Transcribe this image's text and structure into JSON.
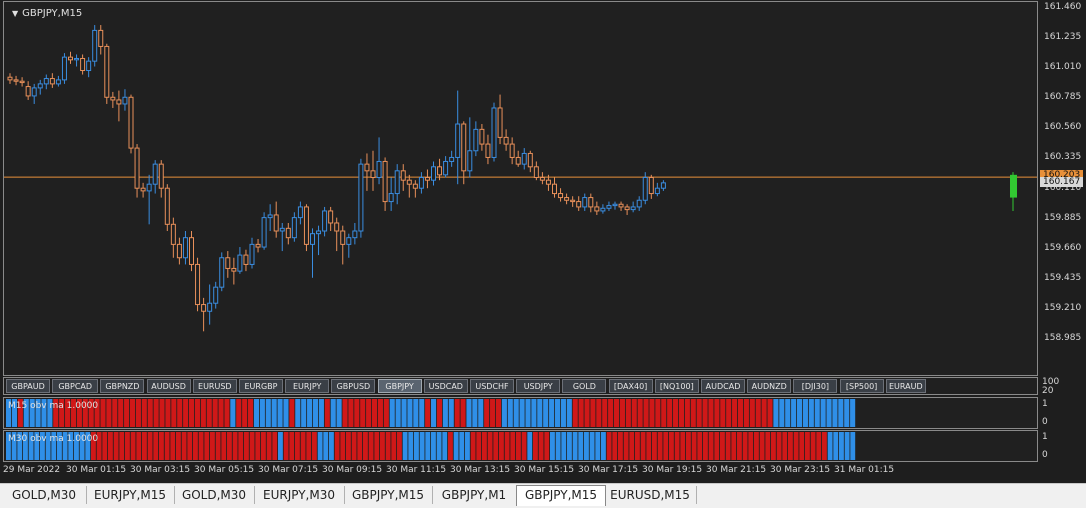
{
  "window": {
    "symbol_label": "GBPJPY,M15"
  },
  "colors": {
    "bull": "#3a8de0",
    "bear": "#e8905a",
    "current_price_line": "#e8903a",
    "ind_bull": "#2f8fe8",
    "ind_bear": "#d01818"
  },
  "price_axis": {
    "ticks": [
      "161.460",
      "161.235",
      "161.010",
      "160.785",
      "160.560",
      "160.335",
      "160.110",
      "159.885",
      "159.660",
      "159.435",
      "159.210",
      "158.985"
    ],
    "current_price_tag": "160.203",
    "bid_tag": "160.167"
  },
  "symbol_buttons": [
    "GBPAUD",
    "GBPCAD",
    "GBPNZD",
    "AUDUSD",
    "EURUSD",
    "EURGBP",
    "EURJPY",
    "GBPUSD",
    "GBPJPY",
    "USDCAD",
    "USDCHF",
    "USDJPY",
    "GOLD",
    "[DAX40]",
    "[NQ100]",
    "AUDCAD",
    "AUDNZD",
    "[DJI30]",
    "[SP500]",
    "EURAUD"
  ],
  "button_axis": {
    "top": "100",
    "bottom": "20"
  },
  "indicators": [
    {
      "title": "M15 obv ma 1.0000",
      "axis_top": "1",
      "axis_bottom": "0",
      "pattern": "BBRBBBBBRRRRRRRRRRRRRRRRRRRRRRRRRRRRRRBRRRBBBBBBRBBBBBRBBRRRRRRRRBBBBBBRBRBBRRBBBRRRBBBBBBBBBBBBRRRRRRRRRRRRRRRRRRRRRRRRRRRRRRRRRRBBBBBBBBBBBBBB"
    },
    {
      "title": "M30 obv ma 1.0000",
      "axis_top": "1",
      "axis_bottom": "0",
      "pattern": "BBBBBBBBBBBBBBBRRRRRRRRRRRRRRRRRRRRRRRRRRRRRRRRRBRRRRRRBBBRRRRRRRRRRRRBBBBBBBBRBBBRRRRRRRRRRBRRRBBBBBBBBBBRRRRRRRRRRRRRRRRRRRRRRRRRRRRRRRRRRRRRRRBBBBB"
    }
  ],
  "time_axis": [
    "29 Mar 2022",
    "30 Mar 01:15",
    "30 Mar 03:15",
    "30 Mar 05:15",
    "30 Mar 07:15",
    "30 Mar 09:15",
    "30 Mar 11:15",
    "30 Mar 13:15",
    "30 Mar 15:15",
    "30 Mar 17:15",
    "30 Mar 19:15",
    "30 Mar 21:15",
    "30 Mar 23:15",
    "31 Mar 01:15"
  ],
  "tabs": [
    "GOLD,M30",
    "EURJPY,M15",
    "GOLD,M30",
    "EURJPY,M30",
    "GBPJPY,M15",
    "GBPJPY,M1",
    "GBPJPY,M15",
    "EURUSD,M15"
  ],
  "active_tab": 6,
  "chart_data": {
    "type": "candlestick",
    "ylim": [
      158.985,
      161.46
    ],
    "current_price": 160.203,
    "candles": [
      [
        160.95,
        160.93,
        160.98,
        160.9
      ],
      [
        160.93,
        160.92,
        160.96,
        160.89
      ],
      [
        160.92,
        160.91,
        160.95,
        160.88
      ],
      [
        160.88,
        160.81,
        160.92,
        160.78
      ],
      [
        160.81,
        160.87,
        160.9,
        160.75
      ],
      [
        160.87,
        160.9,
        160.93,
        160.82
      ],
      [
        160.9,
        160.94,
        160.97,
        160.86
      ],
      [
        160.94,
        160.9,
        160.98,
        160.87
      ],
      [
        160.9,
        160.93,
        160.96,
        160.88
      ],
      [
        160.93,
        161.1,
        161.13,
        160.9
      ],
      [
        161.1,
        161.08,
        161.14,
        161.05
      ],
      [
        161.08,
        161.09,
        161.12,
        161.03
      ],
      [
        161.09,
        161.0,
        161.12,
        160.97
      ],
      [
        161.0,
        161.07,
        161.1,
        160.95
      ],
      [
        161.07,
        161.3,
        161.34,
        161.03
      ],
      [
        161.3,
        161.18,
        161.34,
        161.12
      ],
      [
        161.18,
        160.8,
        161.2,
        160.75
      ],
      [
        160.8,
        160.78,
        160.84,
        160.72
      ],
      [
        160.78,
        160.75,
        160.85,
        160.62
      ],
      [
        160.75,
        160.8,
        160.86,
        160.7
      ],
      [
        160.8,
        160.42,
        160.82,
        160.38
      ],
      [
        160.42,
        160.12,
        160.45,
        160.05
      ],
      [
        160.12,
        160.1,
        160.16,
        160.05
      ],
      [
        160.1,
        160.15,
        160.22,
        159.85
      ],
      [
        160.15,
        160.3,
        160.33,
        160.08
      ],
      [
        160.3,
        160.12,
        160.33,
        160.05
      ],
      [
        160.12,
        159.85,
        160.15,
        159.8
      ],
      [
        159.85,
        159.7,
        159.9,
        159.6
      ],
      [
        159.7,
        159.6,
        159.75,
        159.55
      ],
      [
        159.6,
        159.75,
        159.8,
        159.55
      ],
      [
        159.75,
        159.55,
        159.8,
        159.5
      ],
      [
        159.55,
        159.25,
        159.6,
        159.2
      ],
      [
        159.25,
        159.2,
        159.3,
        159.05
      ],
      [
        159.2,
        159.26,
        159.4,
        159.1
      ],
      [
        159.26,
        159.38,
        159.42,
        159.22
      ],
      [
        159.38,
        159.6,
        159.64,
        159.35
      ],
      [
        159.6,
        159.52,
        159.65,
        159.45
      ],
      [
        159.52,
        159.5,
        159.6,
        159.4
      ],
      [
        159.5,
        159.62,
        159.68,
        159.48
      ],
      [
        159.62,
        159.55,
        159.66,
        159.5
      ],
      [
        159.55,
        159.7,
        159.75,
        159.52
      ],
      [
        159.7,
        159.68,
        159.74,
        159.64
      ],
      [
        159.68,
        159.9,
        159.94,
        159.66
      ],
      [
        159.9,
        159.92,
        160.0,
        159.8
      ],
      [
        159.92,
        159.8,
        160.02,
        159.75
      ],
      [
        159.8,
        159.82,
        159.86,
        159.65
      ],
      [
        159.82,
        159.75,
        159.86,
        159.7
      ],
      [
        159.75,
        159.9,
        159.94,
        159.72
      ],
      [
        159.9,
        159.98,
        160.02,
        159.85
      ],
      [
        159.98,
        159.7,
        160.0,
        159.65
      ],
      [
        159.7,
        159.78,
        159.82,
        159.45
      ],
      [
        159.78,
        159.8,
        159.84,
        159.62
      ],
      [
        159.8,
        159.95,
        159.98,
        159.76
      ],
      [
        159.95,
        159.86,
        159.98,
        159.8
      ],
      [
        159.86,
        159.8,
        159.9,
        159.65
      ],
      [
        159.8,
        159.7,
        159.84,
        159.55
      ],
      [
        159.7,
        159.75,
        159.78,
        159.6
      ],
      [
        159.75,
        159.8,
        159.86,
        159.7
      ],
      [
        159.8,
        160.3,
        160.34,
        159.75
      ],
      [
        160.3,
        160.25,
        160.38,
        160.1
      ],
      [
        160.25,
        160.2,
        160.4,
        160.1
      ],
      [
        160.2,
        160.32,
        160.5,
        160.15
      ],
      [
        160.32,
        160.02,
        160.35,
        159.95
      ],
      [
        160.02,
        160.08,
        160.2,
        159.95
      ],
      [
        160.08,
        160.25,
        160.3,
        160.0
      ],
      [
        160.25,
        160.18,
        160.3,
        160.1
      ],
      [
        160.18,
        160.15,
        160.22,
        160.05
      ],
      [
        160.15,
        160.12,
        160.18,
        160.05
      ],
      [
        160.12,
        160.2,
        160.24,
        160.08
      ],
      [
        160.2,
        160.18,
        160.26,
        160.12
      ],
      [
        160.18,
        160.28,
        160.32,
        160.14
      ],
      [
        160.28,
        160.22,
        160.34,
        160.18
      ],
      [
        160.22,
        160.32,
        160.36,
        160.2
      ],
      [
        160.32,
        160.35,
        160.4,
        160.28
      ],
      [
        160.35,
        160.6,
        160.85,
        160.15
      ],
      [
        160.6,
        160.25,
        160.62,
        160.15
      ],
      [
        160.25,
        160.4,
        160.65,
        160.2
      ],
      [
        160.4,
        160.56,
        160.62,
        160.36
      ],
      [
        160.56,
        160.45,
        160.6,
        160.4
      ],
      [
        160.45,
        160.35,
        160.52,
        160.3
      ],
      [
        160.35,
        160.72,
        160.76,
        160.32
      ],
      [
        160.72,
        160.5,
        160.82,
        160.45
      ],
      [
        160.5,
        160.45,
        160.56,
        160.4
      ],
      [
        160.45,
        160.35,
        160.5,
        160.3
      ],
      [
        160.35,
        160.3,
        160.4,
        160.28
      ],
      [
        160.3,
        160.38,
        160.42,
        160.26
      ],
      [
        160.38,
        160.28,
        160.4,
        160.24
      ],
      [
        160.28,
        160.2,
        160.32,
        160.18
      ],
      [
        160.2,
        160.18,
        160.24,
        160.15
      ],
      [
        160.18,
        160.15,
        160.22,
        160.1
      ],
      [
        160.15,
        160.08,
        160.2,
        160.05
      ],
      [
        160.08,
        160.05,
        160.12,
        160.02
      ],
      [
        160.05,
        160.03,
        160.08,
        160.0
      ],
      [
        160.03,
        160.02,
        160.06,
        159.98
      ],
      [
        160.02,
        159.98,
        160.06,
        159.95
      ],
      [
        159.98,
        160.05,
        160.08,
        159.95
      ],
      [
        160.05,
        159.98,
        160.08,
        159.94
      ],
      [
        159.98,
        159.95,
        160.02,
        159.92
      ],
      [
        159.95,
        159.97,
        160.0,
        159.93
      ],
      [
        159.97,
        159.99,
        160.02,
        159.95
      ],
      [
        159.99,
        160.0,
        160.02,
        159.96
      ],
      [
        160.0,
        159.98,
        160.02,
        159.95
      ],
      [
        159.98,
        159.96,
        160.0,
        159.92
      ],
      [
        159.96,
        159.98,
        160.02,
        159.94
      ],
      [
        159.98,
        160.03,
        160.06,
        159.95
      ],
      [
        160.03,
        160.2,
        160.24,
        160.0
      ],
      [
        160.2,
        160.08,
        160.22,
        160.04
      ],
      [
        160.08,
        160.12,
        160.16,
        160.06
      ],
      [
        160.12,
        160.16,
        160.18,
        160.1
      ]
    ],
    "live_candle": [
      160.05,
      160.22,
      160.24,
      159.95
    ]
  }
}
